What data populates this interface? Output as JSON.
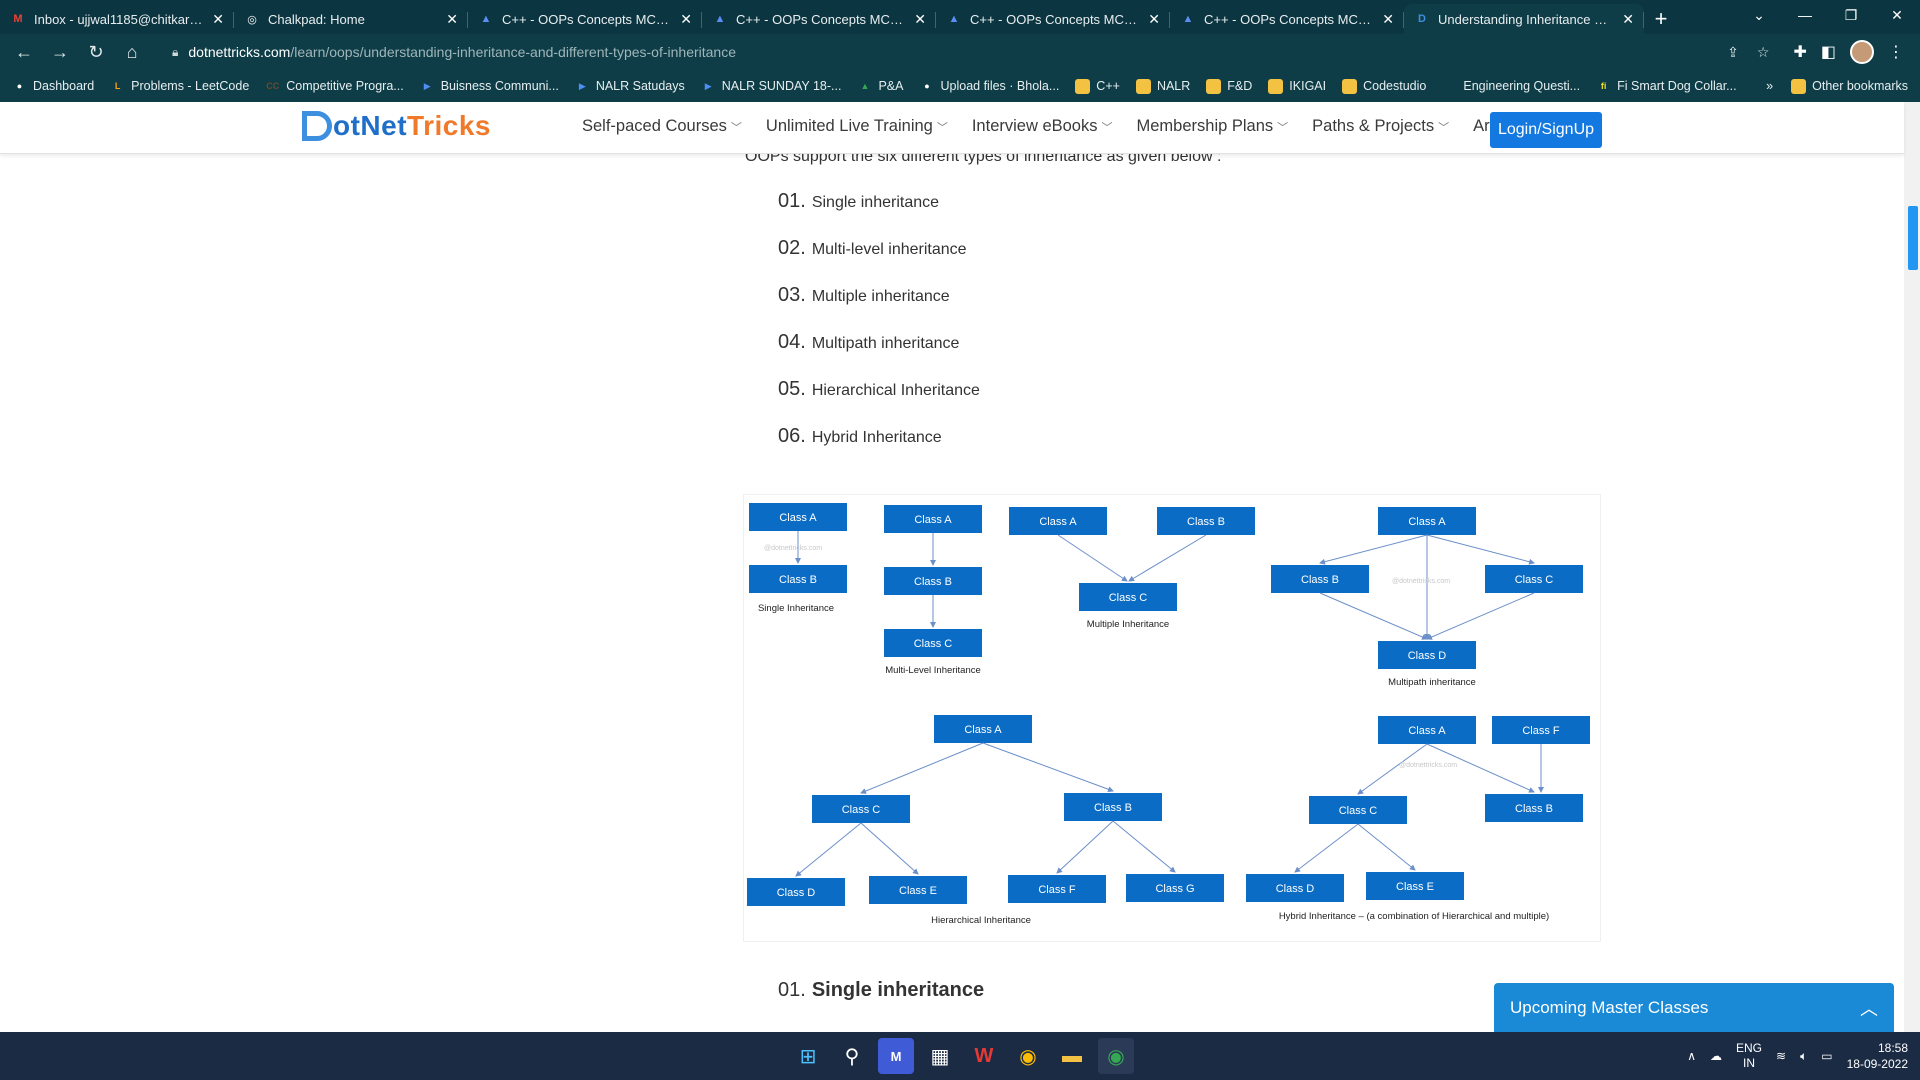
{
  "browser": {
    "tabs": [
      {
        "title": "Inbox - ujjwal1185@chitkara.edu",
        "icon": "gmail-icon",
        "glyph": "M",
        "color": "#ea4335",
        "active": false
      },
      {
        "title": "Chalkpad: Home",
        "icon": "globe-icon",
        "glyph": "◎",
        "color": "#ffffff",
        "active": false
      },
      {
        "title": "C++ - OOPs Concepts MCQs (M",
        "icon": "triangle-logo-icon",
        "glyph": "▲",
        "color": "#5b8df5",
        "active": false
      },
      {
        "title": "C++ - OOPs Concepts MCQs (M",
        "icon": "triangle-logo-icon",
        "glyph": "▲",
        "color": "#5b8df5",
        "active": false
      },
      {
        "title": "C++ - OOPs Concepts MCQs (M",
        "icon": "triangle-logo-icon",
        "glyph": "▲",
        "color": "#5b8df5",
        "active": false
      },
      {
        "title": "C++ - OOPs Concepts MCQs (M",
        "icon": "triangle-logo-icon",
        "glyph": "▲",
        "color": "#5b8df5",
        "active": false
      },
      {
        "title": "Understanding Inheritance and",
        "icon": "dotnettricks-icon",
        "glyph": "D",
        "color": "#3d8fe0",
        "active": true
      }
    ],
    "url_host": "dotnettricks.com",
    "url_path": "/learn/oops/understanding-inheritance-and-different-types-of-inheritance",
    "bookmarks": [
      {
        "label": "Dashboard",
        "icon": "github-icon",
        "color": "#ffffff",
        "glyph": "●"
      },
      {
        "label": "Problems - LeetCode",
        "icon": "leetcode-icon",
        "color": "#f89f1b",
        "glyph": "L"
      },
      {
        "label": "Competitive Progra...",
        "icon": "cc-icon",
        "color": "#6b4b2a",
        "glyph": "CC"
      },
      {
        "label": "Buisness Communi...",
        "icon": "video-icon",
        "color": "#4f8ef7",
        "glyph": "▶"
      },
      {
        "label": "NALR Satudays",
        "icon": "video-icon",
        "color": "#4f8ef7",
        "glyph": "▶"
      },
      {
        "label": "NALR SUNDAY 18-...",
        "icon": "video-icon",
        "color": "#4f8ef7",
        "glyph": "▶"
      },
      {
        "label": "P&A",
        "icon": "drive-icon",
        "color": "#34a853",
        "glyph": "▲"
      },
      {
        "label": "Upload files · Bhola...",
        "icon": "github-icon",
        "color": "#ffffff",
        "glyph": "●"
      },
      {
        "label": "C++",
        "icon": "folder-icon",
        "color": "#f3c243",
        "glyph": ""
      },
      {
        "label": "NALR",
        "icon": "folder-icon",
        "color": "#f3c243",
        "glyph": ""
      },
      {
        "label": "F&D",
        "icon": "folder-icon",
        "color": "#f3c243",
        "glyph": ""
      },
      {
        "label": "IKIGAI",
        "icon": "folder-icon",
        "color": "#f3c243",
        "glyph": ""
      },
      {
        "label": "Codestudio",
        "icon": "folder-icon",
        "color": "#f3c243",
        "glyph": ""
      },
      {
        "label": "Engineering Questi...",
        "icon": "e-icon",
        "color": "#0e3d47",
        "glyph": "E"
      },
      {
        "label": "Fi Smart Dog Collar...",
        "icon": "fi-icon",
        "color": "#f2e01d",
        "glyph": "fi"
      }
    ],
    "other_bookmarks": "Other bookmarks"
  },
  "site": {
    "logo_dot": "otNet",
    "logo_tricks": "Tricks",
    "menu": [
      "Self-paced Courses",
      "Unlimited Live Training",
      "Interview eBooks",
      "Membership Plans",
      "Paths & Projects",
      "Articles"
    ],
    "menu_has_chevron": [
      true,
      true,
      true,
      true,
      true,
      false
    ],
    "login": "Login/SignUp"
  },
  "content": {
    "intro": "OOPs support the six different types of inheritance as given below :",
    "types": [
      {
        "num": "01.",
        "label": "Single inheritance"
      },
      {
        "num": "02.",
        "label": "Multi-level inheritance"
      },
      {
        "num": "03.",
        "label": "Multiple inheritance"
      },
      {
        "num": "04.",
        "label": "Multipath inheritance"
      },
      {
        "num": "05.",
        "label": "Hierarchical Inheritance"
      },
      {
        "num": "06.",
        "label": "Hybrid Inheritance"
      }
    ],
    "subheading_num": "01.",
    "subheading": "Single inheritance"
  },
  "diagram": {
    "box_color": "#0a6cc4",
    "watermark": "@dotnettricks.com",
    "captions": {
      "single": "Single Inheritance",
      "multilevel": "Multi-Level Inheritance",
      "multiple": "Multiple Inheritance",
      "multipath": "Multipath inheritance",
      "hierarchical": "Hierarchical Inheritance",
      "hybrid": "Hybrid Inheritance – (a combination of Hierarchical and multiple)"
    },
    "labels": {
      "a": "Class A",
      "b": "Class B",
      "c": "Class C",
      "d": "Class D",
      "e": "Class E",
      "f": "Class F",
      "g": "Class G"
    }
  },
  "widget": {
    "upcoming": "Upcoming Master Classes"
  },
  "taskbar": {
    "apps": [
      "windows-start-icon",
      "search-icon",
      "visual-studio-icon",
      "store-icon",
      "wps-office-icon",
      "chrome-icon",
      "file-explorer-icon",
      "chrome-profile-icon"
    ],
    "lang_top": "ENG",
    "lang_bottom": "IN",
    "time": "18:58",
    "date": "18-09-2022"
  }
}
